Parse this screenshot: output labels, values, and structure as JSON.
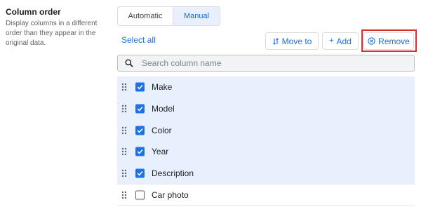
{
  "panel": {
    "title": "Column order",
    "description": "Display columns in a different order than they appear in the original data."
  },
  "mode_toggle": {
    "automatic_label": "Automatic",
    "manual_label": "Manual",
    "selected": "Manual"
  },
  "toolbar": {
    "select_all_label": "Select all",
    "move_to_label": "Move to",
    "add_label": "Add",
    "remove_label": "Remove"
  },
  "search": {
    "placeholder": "Search column name",
    "value": ""
  },
  "columns": [
    {
      "label": "Make",
      "checked": true
    },
    {
      "label": "Model",
      "checked": true
    },
    {
      "label": "Color",
      "checked": true
    },
    {
      "label": "Year",
      "checked": true
    },
    {
      "label": "Description",
      "checked": true
    },
    {
      "label": "Car photo",
      "checked": false
    }
  ],
  "colors": {
    "accent": "#1a73e8",
    "selected_row_bg": "#e8f0fe",
    "highlight_border": "#d93025"
  }
}
